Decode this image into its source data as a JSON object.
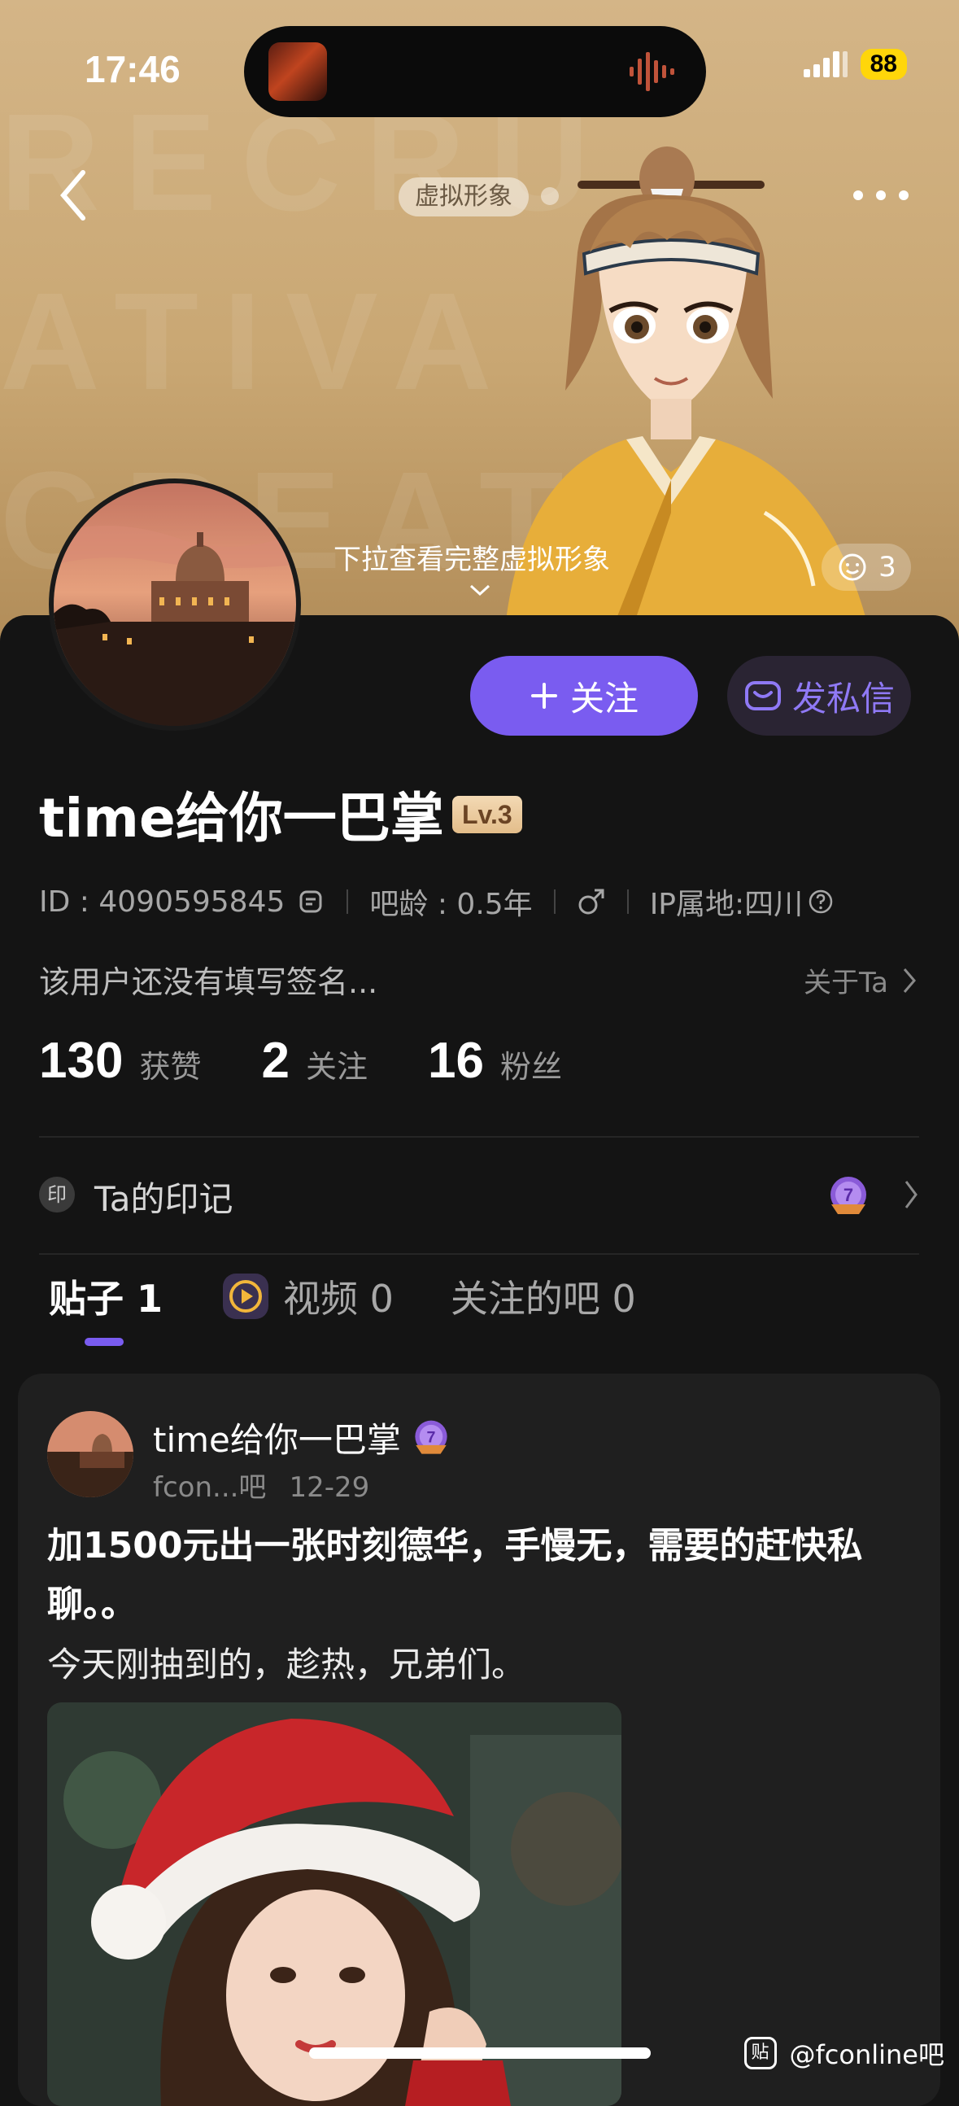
{
  "status_bar": {
    "time": "17:46",
    "battery": "88"
  },
  "header": {
    "chip_label": "虚拟形象"
  },
  "banner": {
    "pull_hint": "下拉查看完整虚拟形象",
    "likes": "3"
  },
  "actions": {
    "follow_label": "关注",
    "dm_label": "发私信"
  },
  "profile": {
    "name": "time给你一巴掌",
    "level": "Lv.3",
    "id_text": "ID : 4090595845",
    "age_text": "吧龄 : 0.5年",
    "ip_text": "IP属地:四川",
    "bio": "该用户还没有填写签名...",
    "about_label": "关于Ta"
  },
  "stats": [
    {
      "value": "130",
      "label": "获赞"
    },
    {
      "value": "2",
      "label": "关注"
    },
    {
      "value": "16",
      "label": "粉丝"
    }
  ],
  "mark": {
    "icon_text": "印",
    "label": "Ta的印记",
    "badge_number": "7"
  },
  "tabs": [
    {
      "label": "贴子 1"
    },
    {
      "label": "视频 0"
    },
    {
      "label": "关注的吧 0"
    }
  ],
  "post": {
    "author": "time给你一巴掌",
    "author_badge": "7",
    "forum": "fcon...吧",
    "date": "12-29",
    "title": "加1500元出一张时刻德华，手慢无，需要的赶快私聊。。",
    "body": "今天刚抽到的，趁热，兄弟们。"
  },
  "watermark": {
    "logo": "贴",
    "text": "@fconline吧"
  },
  "colors": {
    "accent": "#7a5cf0",
    "banner": "#c9a773",
    "background": "#141414"
  }
}
